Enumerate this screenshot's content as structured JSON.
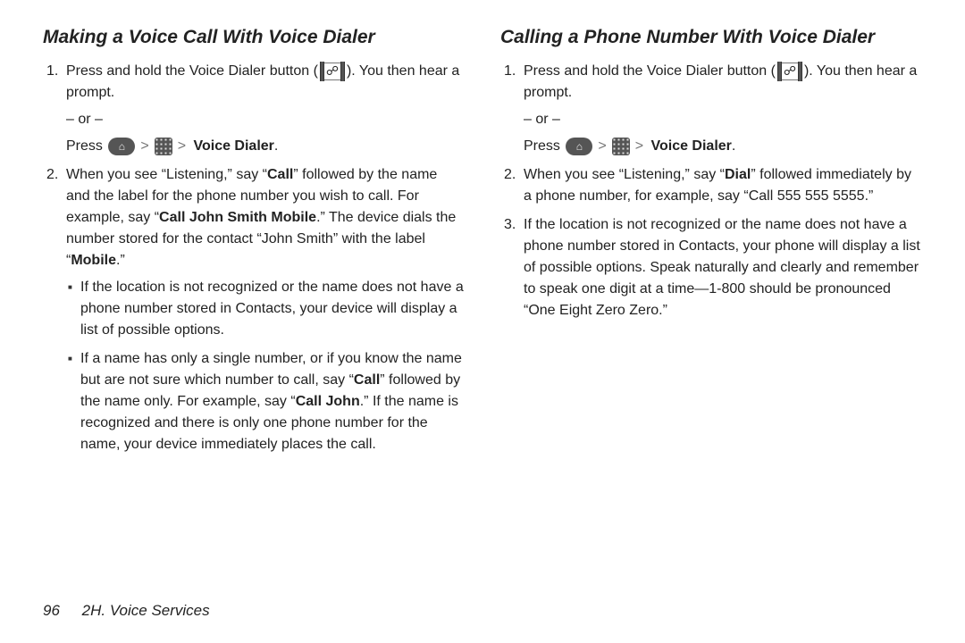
{
  "left": {
    "title": "Making a Voice Call With Voice Dialer",
    "step1_a": "Press and hold the Voice Dialer button (",
    "step1_b": "). You then hear a prompt.",
    "or": "– or –",
    "press_prefix": "Press ",
    "voice_dialer": "Voice Dialer",
    "step2_a": "When you see “Listening,” say “",
    "step2_call": "Call",
    "step2_b": "” followed by the name and the label for the phone number you wish to call. For example, say “",
    "step2_example": "Call John Smith Mobile",
    "step2_c": ".” The device dials the number stored for the contact “John Smith” with the label “",
    "step2_mobile": "Mobile",
    "step2_d": ".”",
    "bullet1": "If the location is not recognized or the name does not have a phone number stored in Contacts, your device will display a list of possible options.",
    "bullet2_a": "If a name has only a single number, or if you know the name but are not sure which number to call, say “",
    "bullet2_call": "Call",
    "bullet2_b": "” followed by the name only. For example, say “",
    "bullet2_example": "Call John",
    "bullet2_c": ".” If the name is recognized and there is only one phone number for the name, your device immediately places the call."
  },
  "right": {
    "title": "Calling a Phone Number With Voice Dialer",
    "step1_a": "Press and hold the Voice Dialer button (",
    "step1_b": "). You then hear a prompt.",
    "or": "– or –",
    "press_prefix": "Press ",
    "voice_dialer": "Voice Dialer",
    "step2_a": "When you see “Listening,” say “",
    "step2_dial": "Dial",
    "step2_b": "” followed immediately by a phone number, for example, say “Call 555 555 5555.”",
    "step3": "If the location is not recognized or the name does not have a phone number stored in Contacts, your phone will display a list of possible options. Speak naturally and clearly and remember to speak one digit at a time—1-800 should be pronounced “One Eight Zero Zero.”"
  },
  "footer": {
    "page": "96",
    "section": "2H. Voice Services"
  }
}
